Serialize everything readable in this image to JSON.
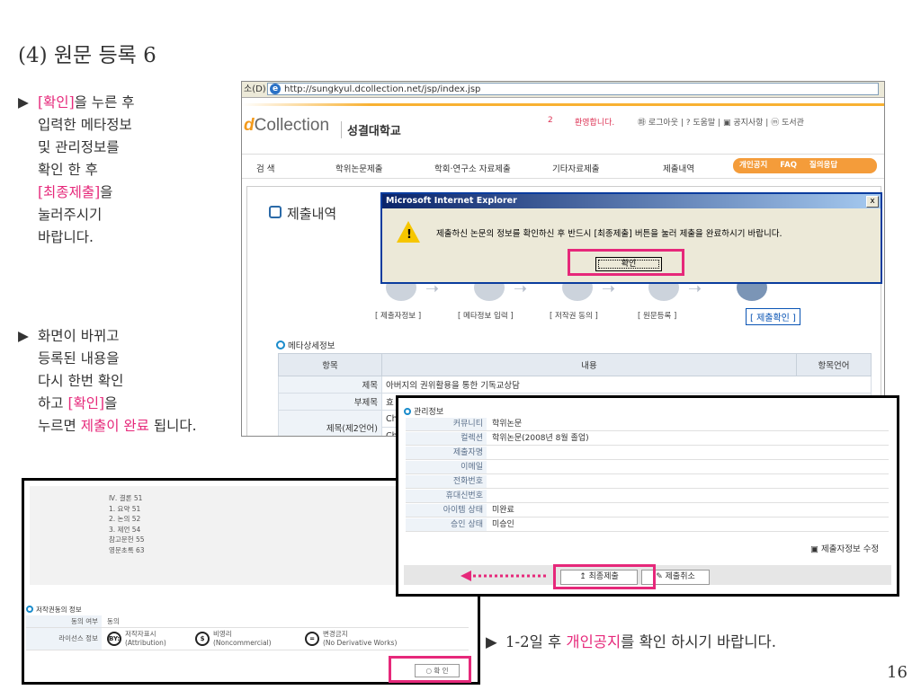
{
  "slide": {
    "title": "(4) 원문 등록 6",
    "bullet1": {
      "lines": [
        {
          "pre": "",
          "hl": "[확인]",
          "post": "을 누른 후"
        },
        {
          "pre": "입력한 메타정보",
          "hl": "",
          "post": ""
        },
        {
          "pre": "및 관리정보를",
          "hl": "",
          "post": ""
        },
        {
          "pre": "확인 한 후",
          "hl": "",
          "post": ""
        },
        {
          "pre": "",
          "hl": "[최종제출]",
          "post": "을"
        },
        {
          "pre": "눌러주시기",
          "hl": "",
          "post": ""
        },
        {
          "pre": "바랍니다.",
          "hl": "",
          "post": ""
        }
      ]
    },
    "bullet2": {
      "line1": "화면이 바뀌고",
      "line2": "등록된 내용을",
      "line3": "다시 한번 확인",
      "line4_pre": "하고 ",
      "line4_hl": "[확인]",
      "line4_post": "을",
      "line5_pre": "누르면 ",
      "line5_hl": "제출이 완료",
      "line5_post": " 됩니다."
    },
    "bullet3": {
      "pre": "1-2일 후 ",
      "hl": "개인공지",
      "post": "를 확인 하시기 바랍니다."
    },
    "page_number": "16",
    "bullet_glyph": "▶",
    "accent_color": "#e6287a"
  },
  "browser": {
    "address_prefix": "소(D)",
    "url": "http://sungkyul.dcollection.net/jsp/index.jsp",
    "logo_d": "d",
    "logo_rest": "Collection",
    "university": "성결대학교",
    "welcome_num": "2",
    "welcome": "환영합니다.",
    "toplinks": "㉺ 로그아웃 | ? 도움말 | ▣ 공지사항 | ⓜ 도서관",
    "nav": {
      "search": "검  색",
      "thesis": "학위논문제출",
      "research": "학회·연구소 자료제출",
      "other": "기타자료제출",
      "history": "제출내역",
      "notice": "개인공지",
      "faq": "FAQ",
      "qna": "질의응답"
    },
    "section_title": "제출내역",
    "steps": [
      "[ 제출자정보 ]",
      "[ 메타정보 입력 ]",
      "[ 저작권 동의 ]",
      "[ 원문등록 ]",
      "[ 제출확인 ]"
    ],
    "meta_heading": "메타상세정보",
    "meta_table": {
      "headers": [
        "항목",
        "내용",
        "항목언어"
      ],
      "rows": [
        {
          "label": "제목",
          "value": "아버지의 권위활용을 통한 기독교상담"
        },
        {
          "label": "부제목",
          "value": "효"
        },
        {
          "label": "제목(제2언어)",
          "value": "Ch"
        },
        {
          "label": "",
          "value": "Ch"
        }
      ]
    }
  },
  "dialog": {
    "title": "Microsoft Internet Explorer",
    "close": "x",
    "message": "제출하신 논문의 정보를 확인하신 후 반드시 [최종제출] 버튼을 눌러 제출을 완료하시기 바랍니다.",
    "ok": "확인"
  },
  "management": {
    "heading": "관리정보",
    "rows": [
      {
        "key": "커뮤니티",
        "value": "학위논문"
      },
      {
        "key": "컬렉션",
        "value": "학위논문(2008년 8월 졸업)"
      },
      {
        "key": "제출자명",
        "value": ""
      },
      {
        "key": "이메일",
        "value": ""
      },
      {
        "key": "전화번호",
        "value": ""
      },
      {
        "key": "휴대신번호",
        "value": ""
      },
      {
        "key": "아이템 상태",
        "value": "미완료"
      },
      {
        "key": "승인 상태",
        "value": "미승인"
      }
    ],
    "edit_link": "▣ 제출자정보 수정",
    "final_submit": "최종제출",
    "cancel_submit": "제출취소"
  },
  "license_panel": {
    "toc": [
      "Ⅳ. 결론 51",
      "1. 요약 51",
      "2. 논의 52",
      "3. 제언 54",
      "참고문헌 55",
      "영문초록 63"
    ],
    "heading": "저작권동의 정보",
    "agree_key": "동의 여부",
    "agree_value": "동의",
    "license_key": "라이선스 정보",
    "licenses": [
      {
        "badge": "BY:",
        "ko": "저작자표시",
        "en": "(Attribution)"
      },
      {
        "badge": "$",
        "ko": "비영리",
        "en": "(Noncommercial)"
      },
      {
        "badge": "=",
        "ko": "변경금지",
        "en": "(No Derivative Works)"
      }
    ],
    "ok": "○ 확 인"
  }
}
